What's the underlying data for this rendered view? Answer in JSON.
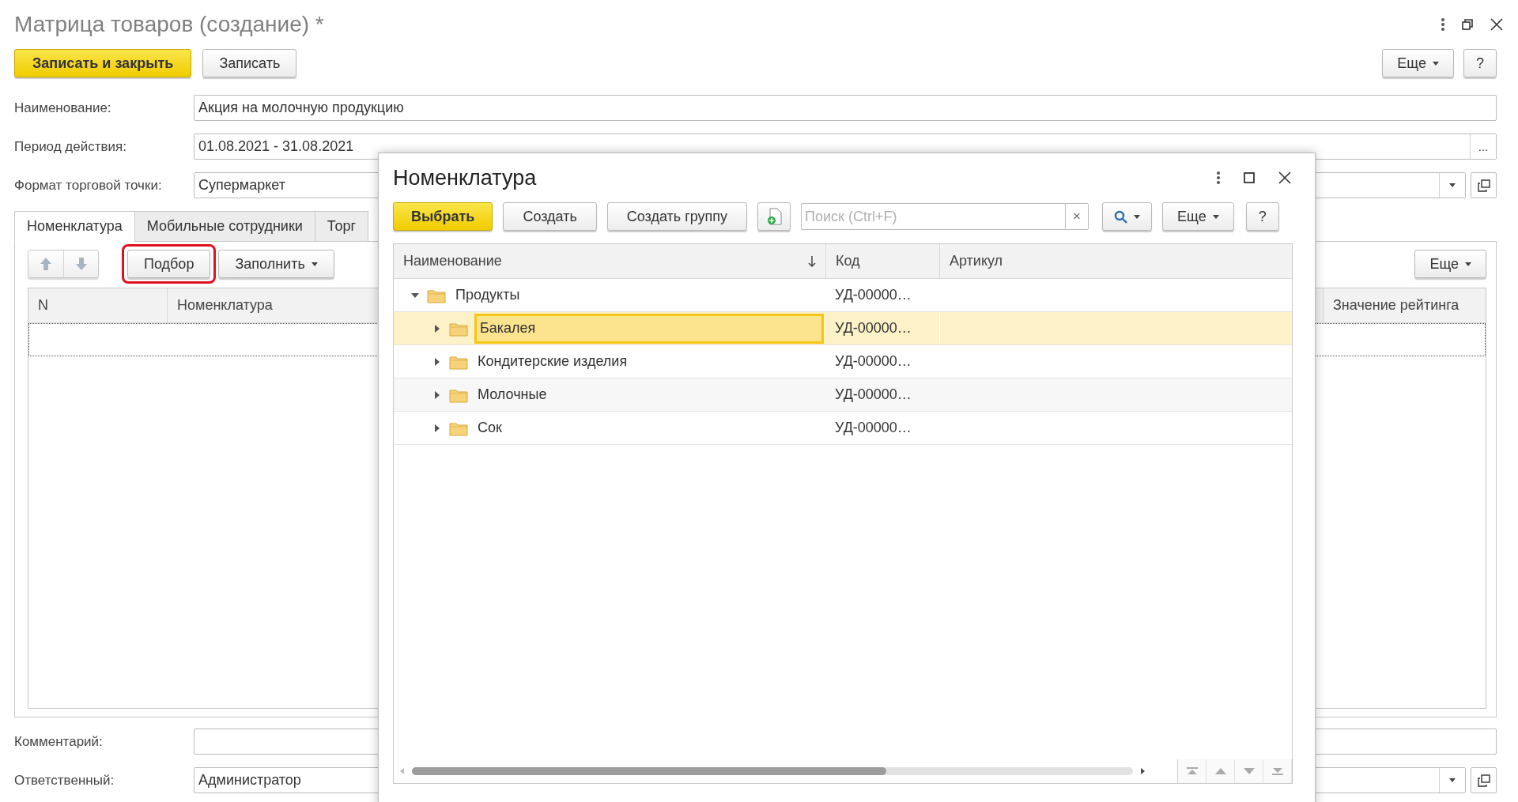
{
  "window": {
    "title": "Матрица товаров (создание) *"
  },
  "toolbar": {
    "buttons": [
      {
        "label": "Записать и закрыть",
        "kind": "primary"
      },
      {
        "label": "Записать",
        "kind": "default"
      }
    ],
    "more": "Еще",
    "help": "?"
  },
  "fields": [
    {
      "label": "Наименование:",
      "value": "Акция на молочную продукцию",
      "kind": "text"
    },
    {
      "label": "Период действия:",
      "value": "01.08.2021 - 31.08.2021",
      "kind": "period",
      "button": "..."
    },
    {
      "label": "Формат торговой точки:",
      "value": "Супермаркет",
      "kind": "choice"
    }
  ],
  "tabs": [
    {
      "label": "Номенклатура",
      "selected": true
    },
    {
      "label": "Мобильные сотрудники",
      "selected": false
    },
    {
      "label": "Торг",
      "selected": false
    }
  ],
  "tab_toolbar": {
    "buttons": [
      {
        "label": "Подбор",
        "kind": "default",
        "highlighted": true
      },
      {
        "label": "Заполнить",
        "kind": "menu",
        "highlighted": false
      }
    ],
    "more": "Еще"
  },
  "table": {
    "columns": [
      "N",
      "Номенклатура",
      "Значение рейтинга"
    ]
  },
  "bottom_fields": [
    {
      "label": "Комментарий:",
      "kind": "text"
    },
    {
      "label": "Ответственный:",
      "value": "Администратор",
      "kind": "choice"
    }
  ],
  "dialog": {
    "title": "Номенклатура",
    "buttons": [
      {
        "label": "Выбрать",
        "kind": "primary"
      },
      {
        "label": "Создать",
        "kind": "default"
      },
      {
        "label": "Создать группу",
        "kind": "default"
      }
    ],
    "search": {
      "placeholder": "Поиск (Ctrl+F)",
      "clear": "×"
    },
    "more": "Еще",
    "help": "?",
    "columns": [
      {
        "label": "Наименование",
        "sorted": true
      },
      {
        "label": "Код",
        "sorted": false
      },
      {
        "label": "Артикул",
        "sorted": false
      }
    ],
    "rows": [
      {
        "name": "Продукты",
        "code": "УД-00000…",
        "expanded": true,
        "selected": false,
        "children": [
          {
            "name": "Бакалея",
            "code": "УД-00000…",
            "expanded": false,
            "selected": true
          },
          {
            "name": "Кондитерские изделия",
            "code": "УД-00000…",
            "expanded": false,
            "selected": false
          },
          {
            "name": "Молочные",
            "code": "УД-00000…",
            "expanded": false,
            "selected": false
          },
          {
            "name": "Сок",
            "code": "УД-00000…",
            "expanded": false,
            "selected": false
          }
        ]
      }
    ]
  }
}
